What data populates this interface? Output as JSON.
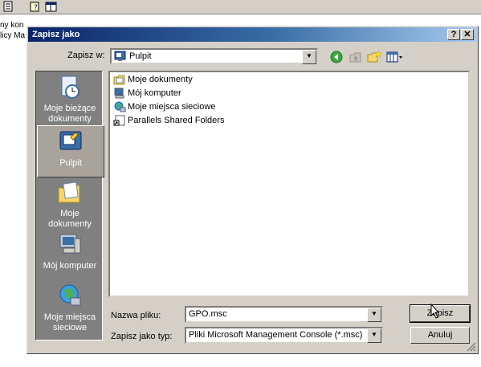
{
  "background": {
    "app_text_line1": "ny kon",
    "app_text_line2": "licy Ma"
  },
  "dialog": {
    "title": "Zapisz jako",
    "help_button": "?",
    "close_button": "✕"
  },
  "look_in": {
    "label": "Zapisz w:",
    "value": "Pulpit"
  },
  "toolbar_icons": [
    "back-icon",
    "up-folder-icon",
    "new-folder-icon",
    "view-menu-icon"
  ],
  "places": [
    {
      "label_line1": "Moje bieżące",
      "label_line2": "dokumenty",
      "icon": "recent-documents-icon"
    },
    {
      "label_line1": "Pulpit",
      "label_line2": "",
      "icon": "desktop-icon",
      "selected": true
    },
    {
      "label_line1": "Moje",
      "label_line2": "dokumenty",
      "icon": "my-documents-icon"
    },
    {
      "label_line1": "Mój komputer",
      "label_line2": "",
      "icon": "my-computer-icon"
    },
    {
      "label_line1": "Moje miejsca",
      "label_line2": "sieciowe",
      "icon": "network-places-icon"
    }
  ],
  "files": [
    {
      "name": "Moje dokumenty",
      "icon": "folder-icon"
    },
    {
      "name": "Mój komputer",
      "icon": "computer-icon"
    },
    {
      "name": "Moje miejsca sieciowe",
      "icon": "network-icon"
    },
    {
      "name": "Parallels Shared Folders",
      "icon": "shortcut-icon"
    }
  ],
  "filename": {
    "label": "Nazwa pliku:",
    "value": "GPO.msc"
  },
  "filetype": {
    "label": "Zapisz jako typ:",
    "value": "Pliki Microsoft Management Console (*.msc)"
  },
  "buttons": {
    "save": "Zapisz",
    "cancel": "Anuluj"
  }
}
